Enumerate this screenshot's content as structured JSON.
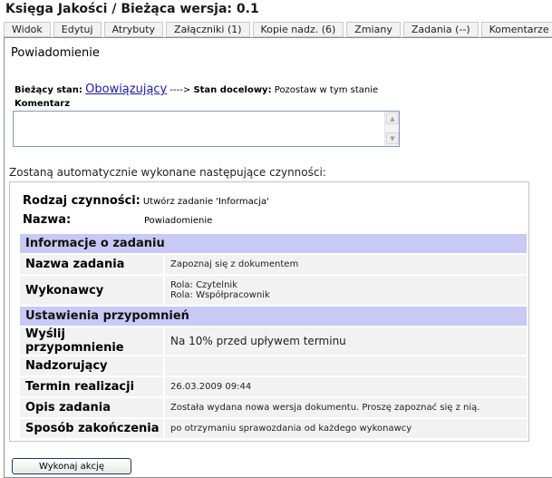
{
  "page_title": "Księga Jakości / Bieżąca wersja: 0.1",
  "tabs": [
    {
      "label": "Widok"
    },
    {
      "label": "Edytuj"
    },
    {
      "label": "Atrybuty"
    },
    {
      "label": "Załączniki (1)"
    },
    {
      "label": "Kopie nadz. (6)"
    },
    {
      "label": "Zmiany"
    },
    {
      "label": "Zadania (--)"
    },
    {
      "label": "Komentarze"
    }
  ],
  "panel_title": "Powiadomienie",
  "state": {
    "current_label": "Bieżący stan:",
    "current_value": "Obowiązujący",
    "arrow": "---->",
    "target_label": "Stan docelowy:",
    "target_value": "Pozostaw w tym stanie"
  },
  "comment": {
    "label": "Komentarz",
    "value": ""
  },
  "auto_actions_text": "Zostaną automatycznie wykonane następujące czynności:",
  "action": {
    "type_label": "Rodzaj czynności:",
    "type_value": "Utwórz zadanie 'Informacja'",
    "name_label": "Nazwa:",
    "name_value": "Powiadomienie"
  },
  "task_section": {
    "title": "Informacje o zadaniu",
    "task_name_label": "Nazwa zadania",
    "task_name_value": "Zapoznaj się z dokumentem",
    "executors_label": "Wykonawcy",
    "executors": [
      "Rola: Czytelnik",
      "Rola: Współpracownik"
    ]
  },
  "reminder_section": {
    "title": "Ustawienia przypomnień",
    "send_reminder_label": "Wyślij przypomnienie",
    "send_reminder_value": "Na 10% przed upływem terminu",
    "supervisors_label": "Nadzorujący",
    "supervisors_value": "",
    "deadline_label": "Termin realizacji",
    "deadline_value": "26.03.2009 09:44",
    "description_label": "Opis zadania",
    "description_value": "Została wydana nowa wersja dokumentu. Proszę zapoznać się z nią.",
    "completion_label": "Sposób zakończenia",
    "completion_value": "po otrzymaniu sprawozdania od każdego wykonawcy"
  },
  "execute_button_label": "Wykonaj akcję"
}
